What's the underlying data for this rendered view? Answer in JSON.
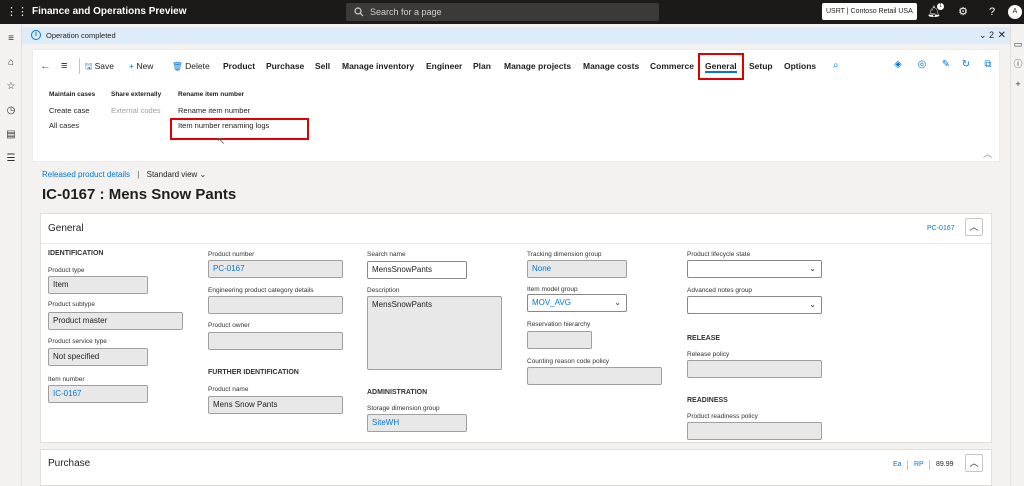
{
  "topbar": {
    "app_title": "Finance and Operations Preview",
    "search_placeholder": "Search for a page",
    "company": "USRT | Contoso Retail USA",
    "notification_count": "1",
    "avatar_initial": "A"
  },
  "message_bar": {
    "text": "Operation completed",
    "count": "2"
  },
  "action_pane": {
    "save": "Save",
    "new": "New",
    "delete": "Delete",
    "tabs": [
      "Product",
      "Purchase",
      "Sell",
      "Manage inventory",
      "Engineer",
      "Plan",
      "Manage projects",
      "Manage costs",
      "Commerce",
      "General",
      "Setup",
      "Options"
    ],
    "selected_tab": "General",
    "groups": {
      "maintain_cases": {
        "header": "Maintain cases",
        "items": [
          "Create case",
          "All cases"
        ]
      },
      "share_externally": {
        "header": "Share externally",
        "items": [
          "External codes"
        ]
      },
      "rename_item_number": {
        "header": "Rename item number",
        "items": [
          "Rename item number",
          "Item number renaming logs"
        ]
      }
    }
  },
  "breadcrumb": {
    "link": "Released product details",
    "view": "Standard view"
  },
  "page_title": "IC-0167 : Mens Snow Pants",
  "general_card": {
    "title": "General",
    "summary": "PC-0167",
    "identification": {
      "header": "IDENTIFICATION",
      "product_type_label": "Product type",
      "product_type": "Item",
      "product_subtype_label": "Product subtype",
      "product_subtype": "Product master",
      "product_service_type_label": "Product service type",
      "product_service_type": "Not specified",
      "item_number_label": "Item number",
      "item_number": "IC-0167"
    },
    "col2": {
      "product_number_label": "Product number",
      "product_number": "PC-0167",
      "engineering_label": "Engineering product category details",
      "engineering": "",
      "product_owner_label": "Product owner",
      "product_owner": "",
      "further_header": "FURTHER IDENTIFICATION",
      "product_name_label": "Product name",
      "product_name": "Mens Snow Pants"
    },
    "col3": {
      "search_name_label": "Search name",
      "search_name": "MensSnowPants",
      "description_label": "Description",
      "description": "MensSnowPants",
      "administration_header": "ADMINISTRATION",
      "storage_label": "Storage dimension group",
      "storage": "SiteWH"
    },
    "col4": {
      "tracking_label": "Tracking dimension group",
      "tracking": "None",
      "item_model_label": "Item model group",
      "item_model": "MOV_AVG",
      "reservation_label": "Reservation hierarchy",
      "reservation": "",
      "counting_label": "Counting reason code policy",
      "counting": ""
    },
    "col5": {
      "lifecycle_label": "Product lifecycle state",
      "lifecycle": "",
      "advanced_notes_label": "Advanced notes group",
      "advanced_notes": "",
      "release_header": "RELEASE",
      "release_policy_label": "Release policy",
      "release_policy": "",
      "readiness_header": "READINESS",
      "readiness_policy_label": "Product readiness policy",
      "readiness_policy": ""
    }
  },
  "purchase_card": {
    "title": "Purchase",
    "unit": "Ea",
    "policy": "RP",
    "price": "89.99"
  }
}
